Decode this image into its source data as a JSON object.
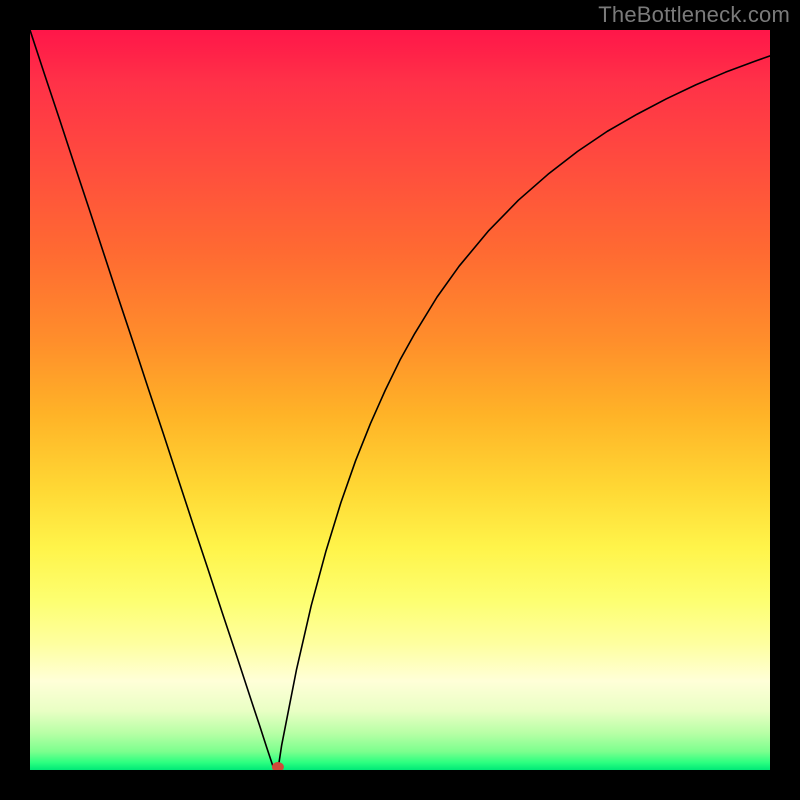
{
  "watermark": "TheBottleneck.com",
  "colors": {
    "frame": "#000000",
    "curve": "#000000",
    "marker": "#d04a3a",
    "gradient_top": "#ff1649",
    "gradient_bottom": "#00e877"
  },
  "chart_data": {
    "type": "line",
    "title": "",
    "xlabel": "",
    "ylabel": "",
    "xlim": [
      0,
      100
    ],
    "ylim": [
      0,
      100
    ],
    "x": [
      0,
      2,
      4,
      6,
      8,
      10,
      12,
      14,
      16,
      18,
      20,
      22,
      24,
      26,
      28,
      30,
      31,
      32,
      33,
      33.5,
      34,
      36,
      38,
      40,
      42,
      44,
      46,
      48,
      50,
      52,
      55,
      58,
      62,
      66,
      70,
      74,
      78,
      82,
      86,
      90,
      94,
      98,
      100
    ],
    "y": [
      100,
      93.9,
      87.9,
      81.8,
      75.8,
      69.7,
      63.6,
      57.6,
      51.5,
      45.5,
      39.4,
      33.3,
      27.3,
      21.2,
      15.2,
      9.1,
      6.1,
      3.0,
      0.0,
      0.0,
      3.3,
      13.5,
      22.2,
      29.6,
      36.1,
      41.8,
      46.8,
      51.3,
      55.4,
      59.0,
      63.9,
      68.1,
      72.9,
      77.0,
      80.5,
      83.6,
      86.3,
      88.6,
      90.7,
      92.6,
      94.3,
      95.8,
      96.5
    ],
    "marker": {
      "x": 33.5,
      "y": 0
    },
    "annotations": [],
    "legend": []
  }
}
